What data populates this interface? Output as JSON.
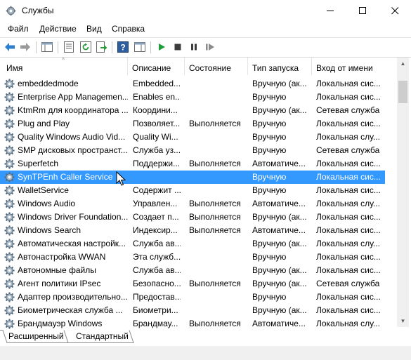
{
  "window": {
    "title": "Службы"
  },
  "menu": [
    "Файл",
    "Действие",
    "Вид",
    "Справка"
  ],
  "columns": [
    "Имя",
    "Описание",
    "Состояние",
    "Тип запуска",
    "Вход от имени"
  ],
  "services": [
    {
      "name": "embeddedmode",
      "desc": "Embedded...",
      "state": "",
      "startup": "Вручную (ак...",
      "logon": "Локальная сис..."
    },
    {
      "name": "Enterprise App Managemen...",
      "desc": "Enables en...",
      "state": "",
      "startup": "Вручную",
      "logon": "Локальная сис..."
    },
    {
      "name": "KtmRm для координатора ...",
      "desc": "Координи...",
      "state": "",
      "startup": "Вручную (ак...",
      "logon": "Сетевая служба"
    },
    {
      "name": "Plug and Play",
      "desc": "Позволяет...",
      "state": "Выполняется",
      "startup": "Вручную",
      "logon": "Локальная сис..."
    },
    {
      "name": "Quality Windows Audio Vid...",
      "desc": "Quality Wi...",
      "state": "",
      "startup": "Вручную",
      "logon": "Локальная слу..."
    },
    {
      "name": "SMP дисковых пространст...",
      "desc": "Служба уз...",
      "state": "",
      "startup": "Вручную",
      "logon": "Сетевая служба"
    },
    {
      "name": "Superfetch",
      "desc": "Поддержи...",
      "state": "Выполняется",
      "startup": "Автоматиче...",
      "logon": "Локальная сис..."
    },
    {
      "name": "SynTPEnh Caller Service",
      "desc": "",
      "state": "",
      "startup": "Вручную",
      "logon": "Локальная сис...",
      "selected": true
    },
    {
      "name": "WalletService",
      "desc": "Содержит ...",
      "state": "",
      "startup": "Вручную",
      "logon": "Локальная сис..."
    },
    {
      "name": "Windows Audio",
      "desc": "Управлен...",
      "state": "Выполняется",
      "startup": "Автоматиче...",
      "logon": "Локальная слу..."
    },
    {
      "name": "Windows Driver Foundation...",
      "desc": "Создает п...",
      "state": "Выполняется",
      "startup": "Вручную (ак...",
      "logon": "Локальная сис..."
    },
    {
      "name": "Windows Search",
      "desc": "Индексир...",
      "state": "Выполняется",
      "startup": "Автоматиче...",
      "logon": "Локальная сис..."
    },
    {
      "name": "Автоматическая настройк...",
      "desc": "Служба ав...",
      "state": "",
      "startup": "Вручную (ак...",
      "logon": "Локальная слу..."
    },
    {
      "name": "Автонастройка WWAN",
      "desc": "Эта служб...",
      "state": "",
      "startup": "Вручную",
      "logon": "Локальная сис..."
    },
    {
      "name": "Автономные файлы",
      "desc": "Служба ав...",
      "state": "",
      "startup": "Вручную (ак...",
      "logon": "Локальная сис..."
    },
    {
      "name": "Агент политики IPsec",
      "desc": "Безопасно...",
      "state": "Выполняется",
      "startup": "Вручную (ак...",
      "logon": "Сетевая служба"
    },
    {
      "name": "Адаптер производительно...",
      "desc": "Предостав...",
      "state": "",
      "startup": "Вручную",
      "logon": "Локальная сис..."
    },
    {
      "name": "Биометрическая служба ...",
      "desc": "Биометри...",
      "state": "",
      "startup": "Вручную (ак...",
      "logon": "Локальная сис..."
    },
    {
      "name": "Брандмауэр Windows",
      "desc": "Брандмау...",
      "state": "Выполняется",
      "startup": "Автоматиче...",
      "logon": "Локальная слу..."
    }
  ],
  "tabs": [
    "Расширенный",
    "Стандартный"
  ],
  "colors": {
    "selection": "#3399ff",
    "running_green": "#1e9e3a"
  }
}
